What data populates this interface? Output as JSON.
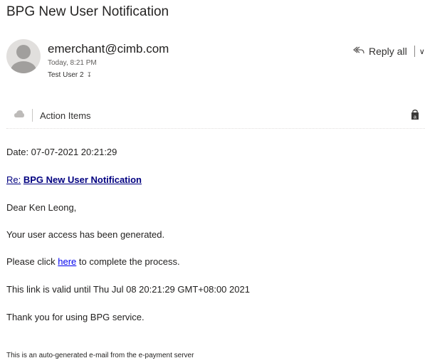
{
  "email": {
    "subject": "BPG New User Notification",
    "sender": "emerchant@cimb.com",
    "time": "Today, 8:21 PM",
    "to": "Test User 2"
  },
  "toolbar": {
    "reply_all_label": "Reply all",
    "action_items_label": "Action Items"
  },
  "body": {
    "date": "Date: 07-07-2021 20:21:29",
    "re_prefix": "Re:",
    "re_title": "BPG New User Notification",
    "greeting": "Dear Ken Leong,",
    "line1": "Your user access has been generated.",
    "line2_before": "Please click",
    "line2_link": "here",
    "line2_after": "to complete the process.",
    "line3": "This link is valid until Thu Jul 08 20:21:29 GMT+08:00 2021",
    "line4": "Thank you for using BPG service.",
    "footer": "This is an auto-generated e-mail from the e-payment server"
  },
  "icons": {
    "avatar": "person-avatar",
    "reply_all": "reply-all-icon",
    "dropdown": "chevron-down-icon",
    "action_items": "cloud-icon",
    "store": "shopping-bag-icon"
  }
}
